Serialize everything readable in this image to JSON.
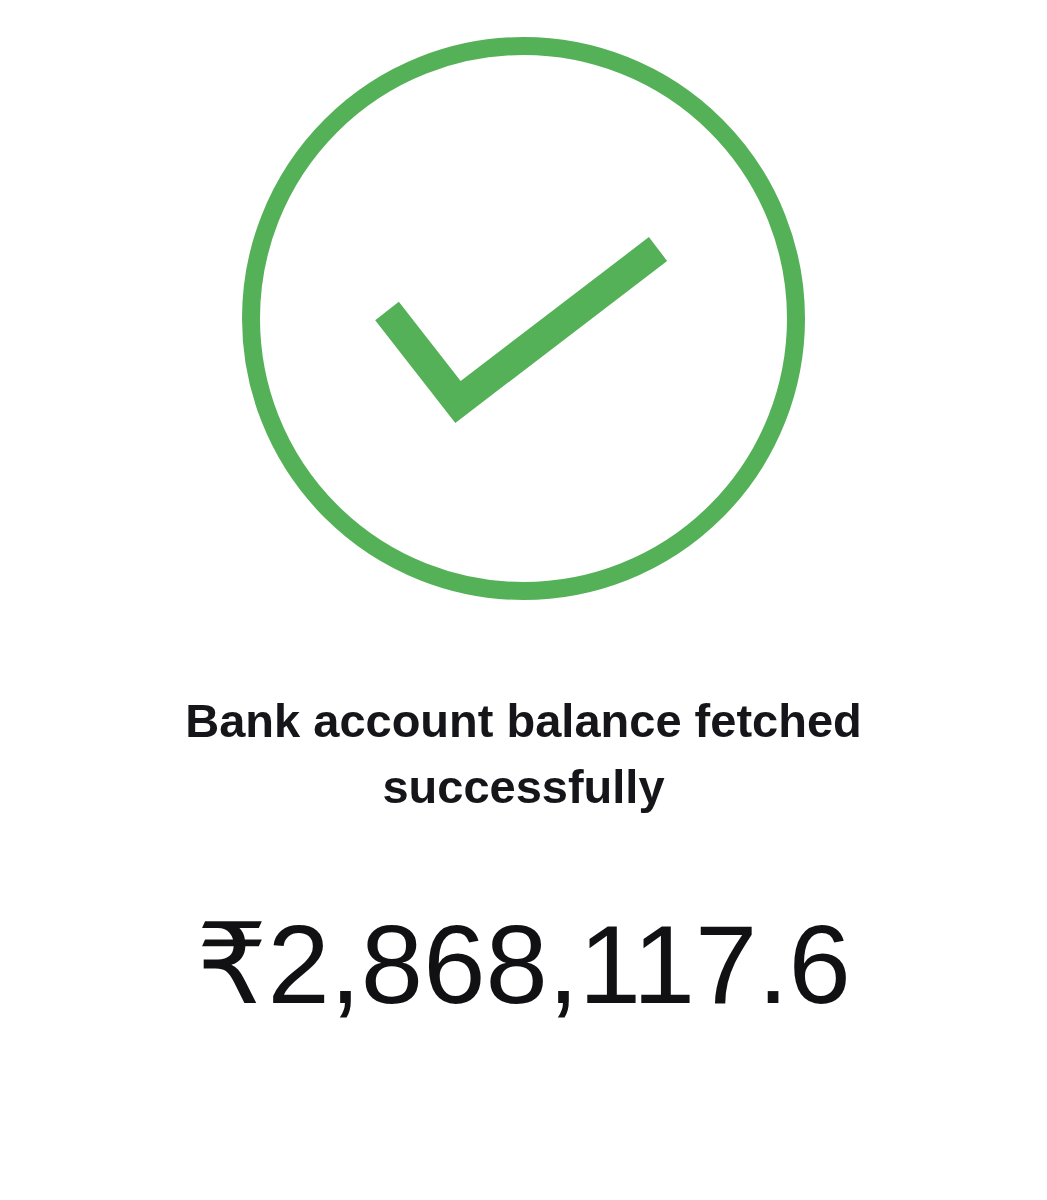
{
  "status": {
    "kind": "success",
    "message": "Bank account balance fetched successfully"
  },
  "balance": {
    "amount": "₹2,868,117.6"
  }
}
